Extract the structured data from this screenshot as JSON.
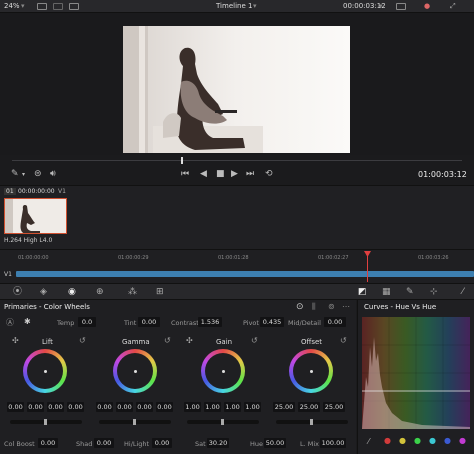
{
  "topbar": {
    "zoom": "24%",
    "title": "Timeline 1",
    "timecode": "00:00:03:12"
  },
  "viewer": {
    "current_timecode": "01:00:03:12"
  },
  "clips": {
    "index": "01",
    "timecode": "00:00:00:00",
    "track": "V1",
    "codec": "H.264 High L4.0"
  },
  "timeline": {
    "track_label": "V1",
    "ruler": [
      "01:00:00:00",
      "01:00:00:29",
      "01:00:01:28",
      "01:00:02:27",
      "01:00:03:26"
    ]
  },
  "primaries": {
    "title": "Primaries - Color Wheels",
    "temp_label": "Temp",
    "temp_value": "0.0",
    "tint_label": "Tint",
    "tint_value": "0.00",
    "contrast_label": "Contrast",
    "contrast_value": "1.536",
    "pivot_label": "Pivot",
    "pivot_value": "0.435",
    "middetail_label": "Mid/Detail",
    "middetail_value": "0.00",
    "wheels": [
      {
        "name": "Lift",
        "values": [
          "0.00",
          "0.00",
          "0.00",
          "0.00"
        ]
      },
      {
        "name": "Gamma",
        "values": [
          "0.00",
          "0.00",
          "0.00",
          "0.00"
        ]
      },
      {
        "name": "Gain",
        "values": [
          "1.00",
          "1.00",
          "1.00",
          "1.00"
        ]
      },
      {
        "name": "Offset",
        "values": [
          "25.00",
          "25.00",
          "25.00"
        ]
      }
    ],
    "colboost_label": "Col Boost",
    "colboost_value": "0.00",
    "shad_label": "Shad",
    "shad_value": "0.00",
    "hilight_label": "Hi/Light",
    "hilight_value": "0.00",
    "sat_label": "Sat",
    "sat_value": "30.20",
    "hue_label": "Hue",
    "hue_value": "50.00",
    "lmix_label": "L. Mix",
    "lmix_value": "100.00"
  },
  "curves": {
    "title": "Curves - Hue Vs Hue",
    "swatches": [
      "#d23b3b",
      "#d2c33b",
      "#3bd24a",
      "#3bc7d2",
      "#3b5ad2",
      "#c23bd2"
    ]
  }
}
